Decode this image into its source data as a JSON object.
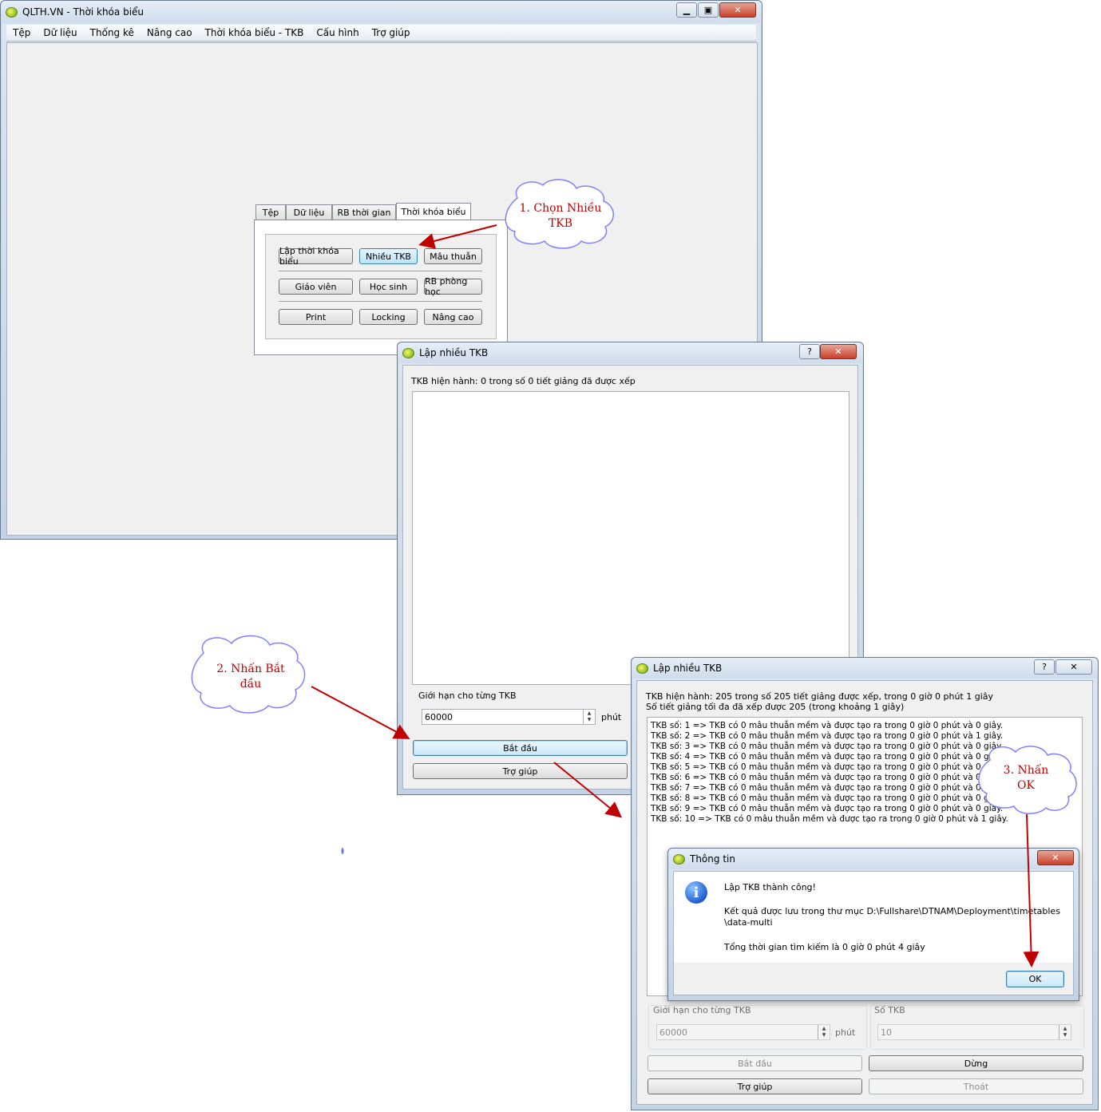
{
  "main_window": {
    "title": "QLTH.VN - Thời khóa biểu",
    "menu": [
      "Tệp",
      "Dữ liệu",
      "Thống kê",
      "Nâng cao",
      "Thời khóa biểu - TKB",
      "Cấu hình",
      "Trợ giúp"
    ]
  },
  "toolpanel": {
    "tabs": [
      "Tệp",
      "Dữ liệu",
      "RB thời gian",
      "Thời khóa biểu"
    ],
    "buttons": [
      "Lập thời khóa biểu",
      "Nhiều TKB",
      "Mâu thuẫn",
      "Giáo viên",
      "Học sinh",
      "RB phòng học",
      "Print",
      "Locking",
      "Nâng cao"
    ]
  },
  "dialog1": {
    "title": "Lập nhiều TKB",
    "help_btn": "?",
    "close_btn": "✕",
    "status": "TKB hiện hành: 0 trong số 0 tiết giảng đã được xếp",
    "limit_label": "Giới hạn cho từng TKB",
    "limit_value": "60000",
    "unit": "phút",
    "start_button": "Bắt đầu",
    "help_button": "Trợ giúp"
  },
  "dialog2": {
    "title": "Lập nhiều TKB",
    "help_btn": "?",
    "close_btn": "✕",
    "status_line1": "TKB hiện hành: 205 trong số 205 tiết giảng được xếp, trong 0 giờ 0 phút 1 giây",
    "status_line2": "Số tiết giảng tối đa đã xếp được 205 (trong khoảng 1 giây)",
    "log": [
      "TKB số: 1 => TKB có 0 mâu thuẫn mềm và được tạo ra trong 0 giờ 0 phút và 0 giây.",
      "TKB số: 2 => TKB có 0 mâu thuẫn mềm và được tạo ra trong 0 giờ 0 phút và 1 giây.",
      "TKB số: 3 => TKB có 0 mâu thuẫn mềm và được tạo ra trong 0 giờ 0 phút và 0 giây.",
      "TKB số: 4 => TKB có 0 mâu thuẫn mềm và được tạo ra trong 0 giờ 0 phút và 0 giây.",
      "TKB số: 5 => TKB có 0 mâu thuẫn mềm và được tạo ra trong 0 giờ 0 phút và 0 giây.",
      "TKB số: 6 => TKB có 0 mâu thuẫn mềm và được tạo ra trong 0 giờ 0 phút và 0 giây.",
      "TKB số: 7 => TKB có 0 mâu thuẫn mềm và được tạo ra trong 0 giờ 0 phút và 0 giây.",
      "TKB số: 8 => TKB có 0 mâu thuẫn mềm và được tạo ra trong 0 giờ 0 phút và 0 giây.",
      "TKB số: 9 => TKB có 0 mâu thuẫn mềm và được tạo ra trong 0 giờ 0 phút và 0 giây.",
      "TKB số: 10 => TKB có 0 mâu thuẫn mềm và được tạo ra trong 0 giờ 0 phút và 1 giây."
    ],
    "limit_label": "Giới hạn cho từng TKB",
    "limit_value": "60000",
    "unit": "phút",
    "count_label": "Số TKB",
    "count_value": "10",
    "start_button": "Bắt đầu",
    "stop_button": "Dừng",
    "help_button": "Trợ giúp",
    "exit_button": "Thoát"
  },
  "info_dialog": {
    "title": "Thông tin",
    "close_btn": "✕",
    "line1": "Lập TKB thành công!",
    "line2a": "Kết quả được lưu trong thư mục D:\\Fullshare\\DTNAM\\Deployment\\timetables",
    "line2b": "\\data-multi",
    "line3": "Tổng thời gian tìm kiếm là 0 giờ 0 phút 4 giây",
    "ok_button": "OK"
  },
  "callouts": {
    "c1_line1": "1. Chọn Nhiều",
    "c1_line2": "TKB",
    "c2_line1": "2. Nhấn Bắt",
    "c2_line2": "đầu",
    "c3_line1": "3. Nhấn",
    "c3_line2": "OK"
  },
  "colors": {
    "annotation": "#c00000",
    "cloud_border": "#8080ff"
  }
}
